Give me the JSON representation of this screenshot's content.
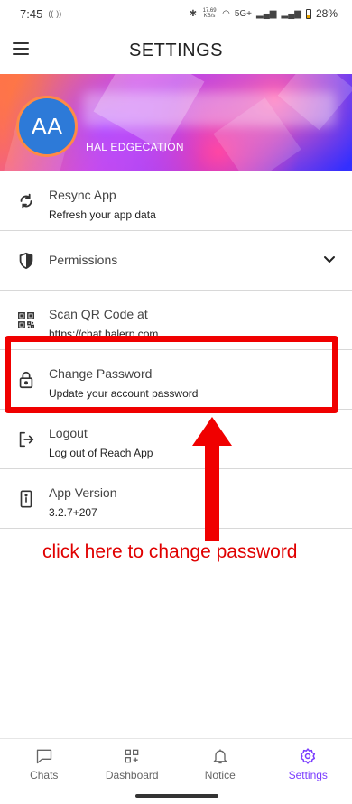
{
  "status_bar": {
    "time": "7:45",
    "network_speed": "17.69 KB/s",
    "network_type": "5G+",
    "battery": "28%"
  },
  "header": {
    "title": "SETTINGS"
  },
  "profile": {
    "initials": "AA",
    "name": "HAL EDGECATION"
  },
  "settings": {
    "resync": {
      "title": "Resync App",
      "subtitle": "Refresh your app data"
    },
    "permissions": {
      "title": "Permissions"
    },
    "scan_qr": {
      "title": "Scan QR Code at",
      "subtitle": "https://chat.halerp.com"
    },
    "change_password": {
      "title": "Change Password",
      "subtitle": "Update your account password"
    },
    "logout": {
      "title": "Logout",
      "subtitle": "Log out of Reach App"
    },
    "app_version": {
      "title": "App Version",
      "subtitle": "3.2.7+207"
    }
  },
  "annotation": {
    "text": "click here to change password",
    "color": "#e00000"
  },
  "bottom_nav": {
    "items": [
      {
        "label": "Chats",
        "icon": "chat-bubble-icon"
      },
      {
        "label": "Dashboard",
        "icon": "dashboard-grid-icon"
      },
      {
        "label": "Notice",
        "icon": "bell-icon"
      },
      {
        "label": "Settings",
        "icon": "gear-icon",
        "active": true
      }
    ],
    "active_color": "#7a3cff"
  }
}
